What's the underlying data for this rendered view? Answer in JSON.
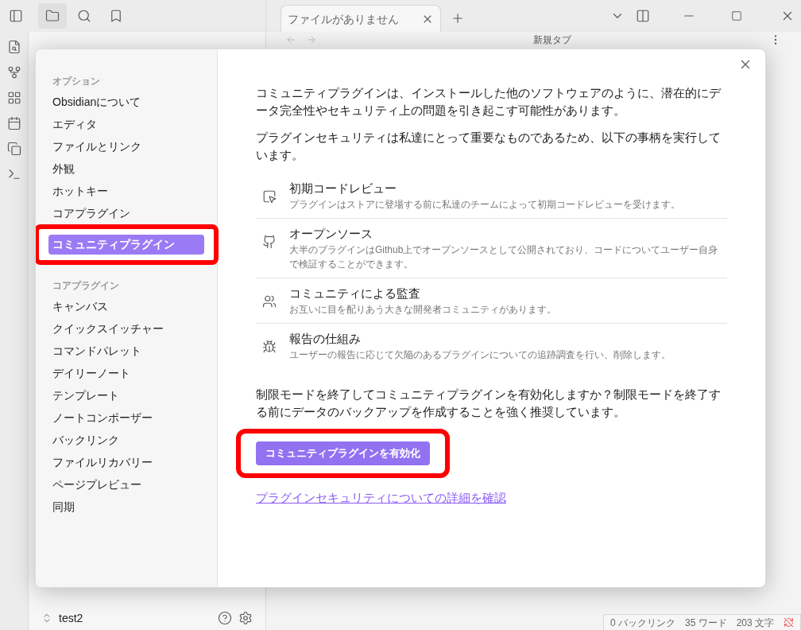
{
  "window": {
    "tabs": [
      {
        "label": "ファイルがありません",
        "selected": true
      }
    ],
    "nav_title": "新規タブ"
  },
  "vault": {
    "name": "test2"
  },
  "status_bar": [
    "0 バックリンク",
    "35 ワード",
    "203 文字"
  ],
  "settings": {
    "sections": [
      {
        "title": "オプション",
        "items": [
          {
            "label": "Obsidianについて",
            "selected": false,
            "highlighted": false
          },
          {
            "label": "エディタ",
            "selected": false,
            "highlighted": false
          },
          {
            "label": "ファイルとリンク",
            "selected": false,
            "highlighted": false
          },
          {
            "label": "外観",
            "selected": false,
            "highlighted": false
          },
          {
            "label": "ホットキー",
            "selected": false,
            "highlighted": false
          },
          {
            "label": "コアプラグイン",
            "selected": false,
            "highlighted": false
          },
          {
            "label": "コミュニティプラグイン",
            "selected": true,
            "highlighted": true
          }
        ]
      },
      {
        "title": "コアプラグイン",
        "items": [
          {
            "label": "キャンバス",
            "selected": false,
            "highlighted": false
          },
          {
            "label": "クイックスイッチャー",
            "selected": false,
            "highlighted": false
          },
          {
            "label": "コマンドパレット",
            "selected": false,
            "highlighted": false
          },
          {
            "label": "デイリーノート",
            "selected": false,
            "highlighted": false
          },
          {
            "label": "テンプレート",
            "selected": false,
            "highlighted": false
          },
          {
            "label": "ノートコンポーザー",
            "selected": false,
            "highlighted": false
          },
          {
            "label": "バックリンク",
            "selected": false,
            "highlighted": false
          },
          {
            "label": "ファイルリカバリー",
            "selected": false,
            "highlighted": false
          },
          {
            "label": "ページプレビュー",
            "selected": false,
            "highlighted": false
          },
          {
            "label": "同期",
            "selected": false,
            "highlighted": false
          }
        ]
      }
    ]
  },
  "content": {
    "intro": [
      "コミュニティプラグインは、インストールした他のソフトウェアのように、潜在的にデータ完全性やセキュリティ上の問題を引き起こす可能性があります。",
      "プラグインセキュリティは私達にとって重要なものであるため、以下の事柄を実行しています。"
    ],
    "features": [
      {
        "kind": "review",
        "title": "初期コードレビュー",
        "description": "プラグインはストアに登場する前に私達のチームによって初期コードレビューを受けます。"
      },
      {
        "kind": "opensource",
        "title": "オープンソース",
        "description": "大半のプラグインはGithub上でオープンソースとして公開されており、コードについてユーザー自身で検証することができます。"
      },
      {
        "kind": "community",
        "title": "コミュニティによる監査",
        "description": "お互いに目を配りあう大きな開発者コミュニティがあります。"
      },
      {
        "kind": "bug",
        "title": "報告の仕組み",
        "description": "ユーザーの報告に応じて欠陥のあるプラグインについての追跡調査を行い、削除します。"
      }
    ],
    "prompt": "制限モードを終了してコミュニティプラグインを有効化しますか？制限モードを終了する前にデータのバックアップを作成することを強く推奨しています。",
    "button": {
      "label": "コミュニティプラグインを有効化",
      "highlighted": true
    },
    "link": "プラグインセキュリティについての詳細を確認"
  }
}
